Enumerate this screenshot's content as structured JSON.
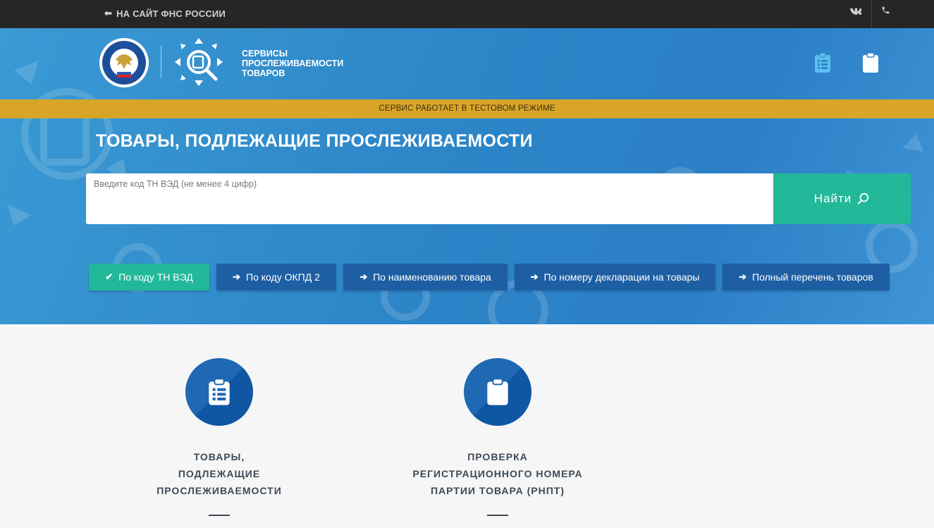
{
  "topbar": {
    "back_label": "НА САЙТ ФНС РОССИИ",
    "vk_label": "VK"
  },
  "header": {
    "service_title": "СЕРВИСЫ ПРОСЛЕЖИВАЕМОСТИ ТОВАРОВ",
    "notice": "СЕРВИС РАБОТАЕТ В ТЕСТОВОМ РЕЖИМЕ"
  },
  "main": {
    "title": "ТОВАРЫ, ПОДЛЕЖАЩИЕ ПРОСЛЕЖИВАЕМОСТИ",
    "search_placeholder": "Введите код ТН ВЭД (не менее 4 цифр)",
    "search_button": "Найти",
    "tabs": [
      {
        "label": "По коду ТН ВЭД",
        "active": true
      },
      {
        "label": "По коду ОКПД 2",
        "active": false
      },
      {
        "label": "По наименованию товара",
        "active": false
      },
      {
        "label": "По номеру декларации на товары",
        "active": false
      },
      {
        "label": "Полный перечень товаров",
        "active": false
      }
    ]
  },
  "cards": [
    {
      "line1": "ТОВАРЫ,",
      "line2": "ПОДЛЕЖАЩИЕ",
      "line3": "ПРОСЛЕЖИВАЕМОСТИ",
      "icon": "clipboard-list-icon"
    },
    {
      "line1": "ПРОВЕРКА",
      "line2": "РЕГИСТРАЦИОННОГО НОМЕРА",
      "line3": "ПАРТИИ ТОВАРА (РНПТ)",
      "icon": "clipboard-icon"
    }
  ],
  "colors": {
    "topbar": "#262626",
    "hero": "#2d86c8",
    "notice": "#d9a528",
    "accent_green": "#22b89a",
    "tab_blue": "#1e5fa3",
    "card_circle": "#1f68b3"
  }
}
